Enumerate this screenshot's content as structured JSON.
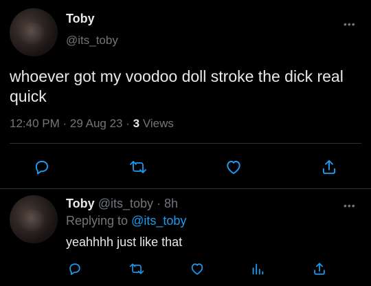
{
  "main_tweet": {
    "author_name": "Toby",
    "author_handle": "@its_toby",
    "more_label": "•••",
    "text": "whoever got my voodoo doll stroke the dick real quick",
    "time": "12:40 PM",
    "sep1": "·",
    "date": "29 Aug 23",
    "sep2": "·",
    "views_count": "3",
    "views_label": "Views",
    "actions": [
      "reply-icon",
      "retweet-icon",
      "like-icon",
      "share-icon"
    ]
  },
  "reply_tweet": {
    "author_name": "Toby",
    "author_handle": "@its_toby",
    "dot": "·",
    "time": "8h",
    "more_label": "•••",
    "replying_prefix": "Replying to",
    "replying_to": "@its_toby",
    "text": "yeahhhh just like that",
    "actions": [
      "reply-icon",
      "retweet-icon",
      "like-icon",
      "analytics-icon",
      "share-icon"
    ]
  },
  "colors": {
    "background": "#000000",
    "text": "#e7e9ea",
    "muted": "#71767b",
    "link": "#1d9bf0",
    "divider": "#2f3336"
  }
}
